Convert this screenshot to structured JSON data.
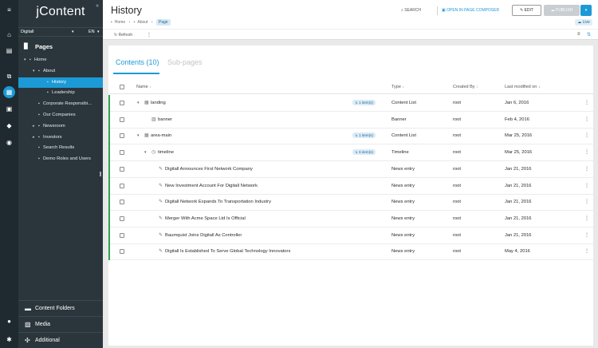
{
  "app": {
    "brand": "jContent"
  },
  "rail": [
    {
      "name": "menu-icon",
      "glyph": "≡"
    },
    {
      "name": "home-icon",
      "glyph": "⌂"
    },
    {
      "name": "clipboard-icon",
      "glyph": "▤"
    },
    {
      "name": "pages-icon",
      "glyph": "⧉"
    },
    {
      "name": "jcontent-icon",
      "glyph": "▦",
      "active": true
    },
    {
      "name": "forms-icon",
      "glyph": "▣"
    },
    {
      "name": "tag-icon",
      "glyph": "◆"
    },
    {
      "name": "compass-icon",
      "glyph": "◉"
    },
    {
      "name": "user-icon",
      "glyph": "●"
    },
    {
      "name": "settings-icon",
      "glyph": "✱"
    }
  ],
  "panel": {
    "collapse_glyph": "«",
    "site": "Digitall",
    "lang": "EN",
    "pages_label": "Pages",
    "tree": [
      {
        "label": "Home",
        "depth": 0,
        "caret": "▾"
      },
      {
        "label": "About",
        "depth": 1,
        "caret": "▾"
      },
      {
        "label": "History",
        "depth": 2,
        "caret": "",
        "selected": true
      },
      {
        "label": "Leadership",
        "depth": 2,
        "caret": ""
      },
      {
        "label": "Corporate Responsibi...",
        "depth": 1,
        "caret": ""
      },
      {
        "label": "Our Companies",
        "depth": 1,
        "caret": ""
      },
      {
        "label": "Newsroom",
        "depth": 1,
        "caret": "▸"
      },
      {
        "label": "Investors",
        "depth": 1,
        "caret": "▸"
      },
      {
        "label": "Search Results",
        "depth": 1,
        "caret": ""
      },
      {
        "label": "Demo Roles and Users",
        "depth": 1,
        "caret": ""
      }
    ],
    "bottom": [
      {
        "name": "content-folders",
        "label": "Content Folders",
        "icon": "▬"
      },
      {
        "name": "media",
        "label": "Media",
        "icon": "▧"
      },
      {
        "name": "additional",
        "label": "Additional",
        "icon": "✣"
      }
    ]
  },
  "header": {
    "title": "History",
    "breadcrumb": [
      "Home",
      "›",
      "About",
      "›"
    ],
    "chip": "Page",
    "search": "SEARCH",
    "composer": "OPEN IN PAGE COMPOSER",
    "edit": "EDIT",
    "publish": "PUBLISH",
    "publish_caret": "▾",
    "live": "Live",
    "refresh": "Refresh",
    "more": "⋮",
    "view_list": "≡",
    "view_struct": "⇅"
  },
  "tabs": {
    "active": "Contents (10)",
    "inactive": "Sub-pages"
  },
  "table": {
    "headers": {
      "name": "Name",
      "type": "Type",
      "created_by": "Created By",
      "last_modified": "Last modified on"
    },
    "sort_arrow": "↓",
    "kebab": "⋮",
    "rows": [
      {
        "name": "landing",
        "type": "Content List",
        "created_by": "root",
        "modified": "Jan 6, 2016",
        "indent": 0,
        "caret": "▾",
        "icon": "▦",
        "badge": "↳ 1 item(s)",
        "bar": true
      },
      {
        "name": "banner",
        "type": "Banner",
        "created_by": "root",
        "modified": "Feb 4, 2016",
        "indent": 1,
        "caret": "",
        "icon": "▨",
        "badge": "",
        "bar": true
      },
      {
        "name": "area-main",
        "type": "Content List",
        "created_by": "root",
        "modified": "Mar 25, 2016",
        "indent": 0,
        "caret": "▾",
        "icon": "▦",
        "badge": "↳ 1 item(s)",
        "bar": true
      },
      {
        "name": "timeline",
        "type": "Timeline",
        "created_by": "root",
        "modified": "Mar 25, 2016",
        "indent": 1,
        "caret": "▾",
        "icon": "◷",
        "badge": "↳ 6 item(s)",
        "bar": true
      },
      {
        "name": "Digitall Announces First Network Company",
        "type": "News entry",
        "created_by": "root",
        "modified": "Jan 21, 2016",
        "indent": 2,
        "caret": "",
        "icon": "✎",
        "badge": "",
        "bar": true
      },
      {
        "name": "New Investment Account For Digitall Network",
        "type": "News entry",
        "created_by": "root",
        "modified": "Jan 21, 2016",
        "indent": 2,
        "caret": "",
        "icon": "✎",
        "badge": "",
        "bar": true
      },
      {
        "name": "Digitall Network Expands To Transportation Industry",
        "type": "News entry",
        "created_by": "root",
        "modified": "Jan 21, 2016",
        "indent": 2,
        "caret": "",
        "icon": "✎",
        "badge": "",
        "bar": true
      },
      {
        "name": "Merger With Acme Space Ltd Is Official",
        "type": "News entry",
        "created_by": "root",
        "modified": "Jan 21, 2016",
        "indent": 2,
        "caret": "",
        "icon": "✎",
        "badge": "",
        "bar": true
      },
      {
        "name": "Baumquist Joins Digitall As Controller",
        "type": "News entry",
        "created_by": "root",
        "modified": "Jan 21, 2016",
        "indent": 2,
        "caret": "",
        "icon": "✎",
        "badge": "",
        "bar": true
      },
      {
        "name": "Digitall Is Established To Serve Global Technology Innovators",
        "type": "News entry",
        "created_by": "root",
        "modified": "May 4, 2016",
        "indent": 2,
        "caret": "",
        "icon": "✎",
        "badge": "",
        "bar": true
      }
    ]
  },
  "colors": {
    "accent": "#1c9ad6",
    "published_bar": "#2ea44f",
    "sidebar": "#2b363c",
    "rail": "#1f2a30"
  }
}
